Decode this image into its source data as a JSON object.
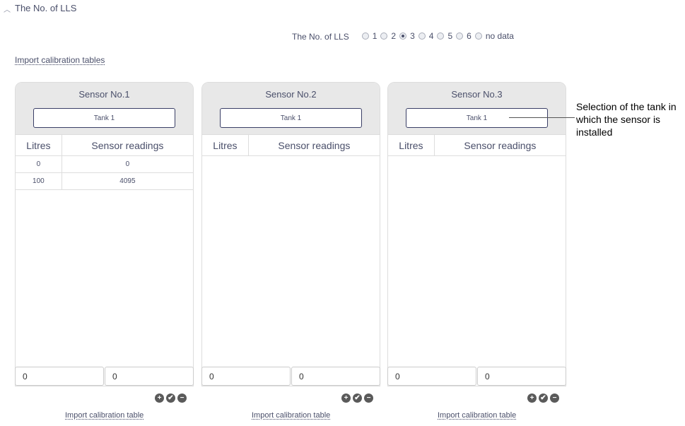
{
  "section": {
    "title": "The No. of LLS",
    "caret_icon": "caret-up-icon"
  },
  "lls_selector": {
    "label": "The No. of LLS",
    "options": [
      "1",
      "2",
      "3",
      "4",
      "5",
      "6",
      "no data"
    ],
    "selected": "3"
  },
  "import_all_label": "Import calibration tables",
  "sensors": [
    {
      "title": "Sensor No.1",
      "tank": "Tank 1",
      "columns": [
        "Litres",
        "Sensor readings"
      ],
      "rows": [
        [
          "0",
          "0"
        ],
        [
          "100",
          "4095"
        ]
      ],
      "input_litres": "0",
      "input_readings": "0",
      "import_label": "Import calibration table"
    },
    {
      "title": "Sensor No.2",
      "tank": "Tank 1",
      "columns": [
        "Litres",
        "Sensor readings"
      ],
      "rows": [],
      "input_litres": "0",
      "input_readings": "0",
      "import_label": "Import calibration table"
    },
    {
      "title": "Sensor No.3",
      "tank": "Tank 1",
      "columns": [
        "Litres",
        "Sensor readings"
      ],
      "rows": [],
      "input_litres": "0",
      "input_readings": "0",
      "import_label": "Import calibration table"
    }
  ],
  "actions": {
    "add": "+",
    "confirm": "✔",
    "remove": "−"
  },
  "callout": "Selection of the tank in which the sensor is installed"
}
